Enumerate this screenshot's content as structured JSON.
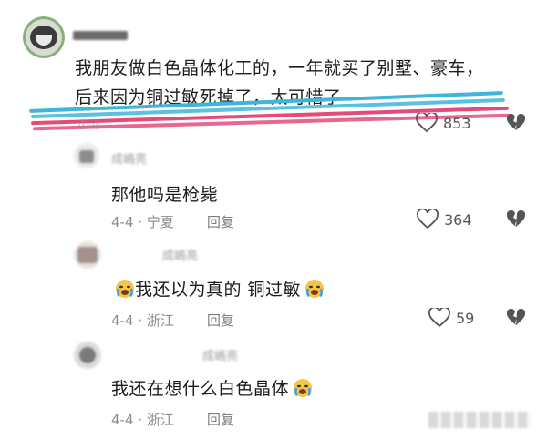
{
  "comments": [
    {
      "username": "",
      "text_line1": "我朋友做白色晶体化工的，一年就买了别墅、豪车，",
      "text_line2": "后来因为铜过敏死掉了，太可惜了",
      "date": "4-4",
      "location": "宁夏",
      "likes": "853"
    },
    {
      "username": "成嶋亮",
      "text": "那他吗是枪毙",
      "date": "4-4",
      "location": "宁夏",
      "reply_label": "回复",
      "likes": "364"
    },
    {
      "username": "成嶋亮",
      "text": "我还以为真的 铜过敏",
      "date": "4-4",
      "location": "浙江",
      "reply_label": "回复",
      "likes": "59"
    },
    {
      "username": "成嶋亮",
      "text": "我还在想什么白色晶体",
      "date": "4-4",
      "location": "浙江",
      "reply_label": "回复"
    }
  ],
  "annotation_colors": [
    "#3fb6d8",
    "#e54b7a"
  ],
  "icons": [
    "heart-icon",
    "broken-heart-icon",
    "crying-emoji-icon"
  ]
}
